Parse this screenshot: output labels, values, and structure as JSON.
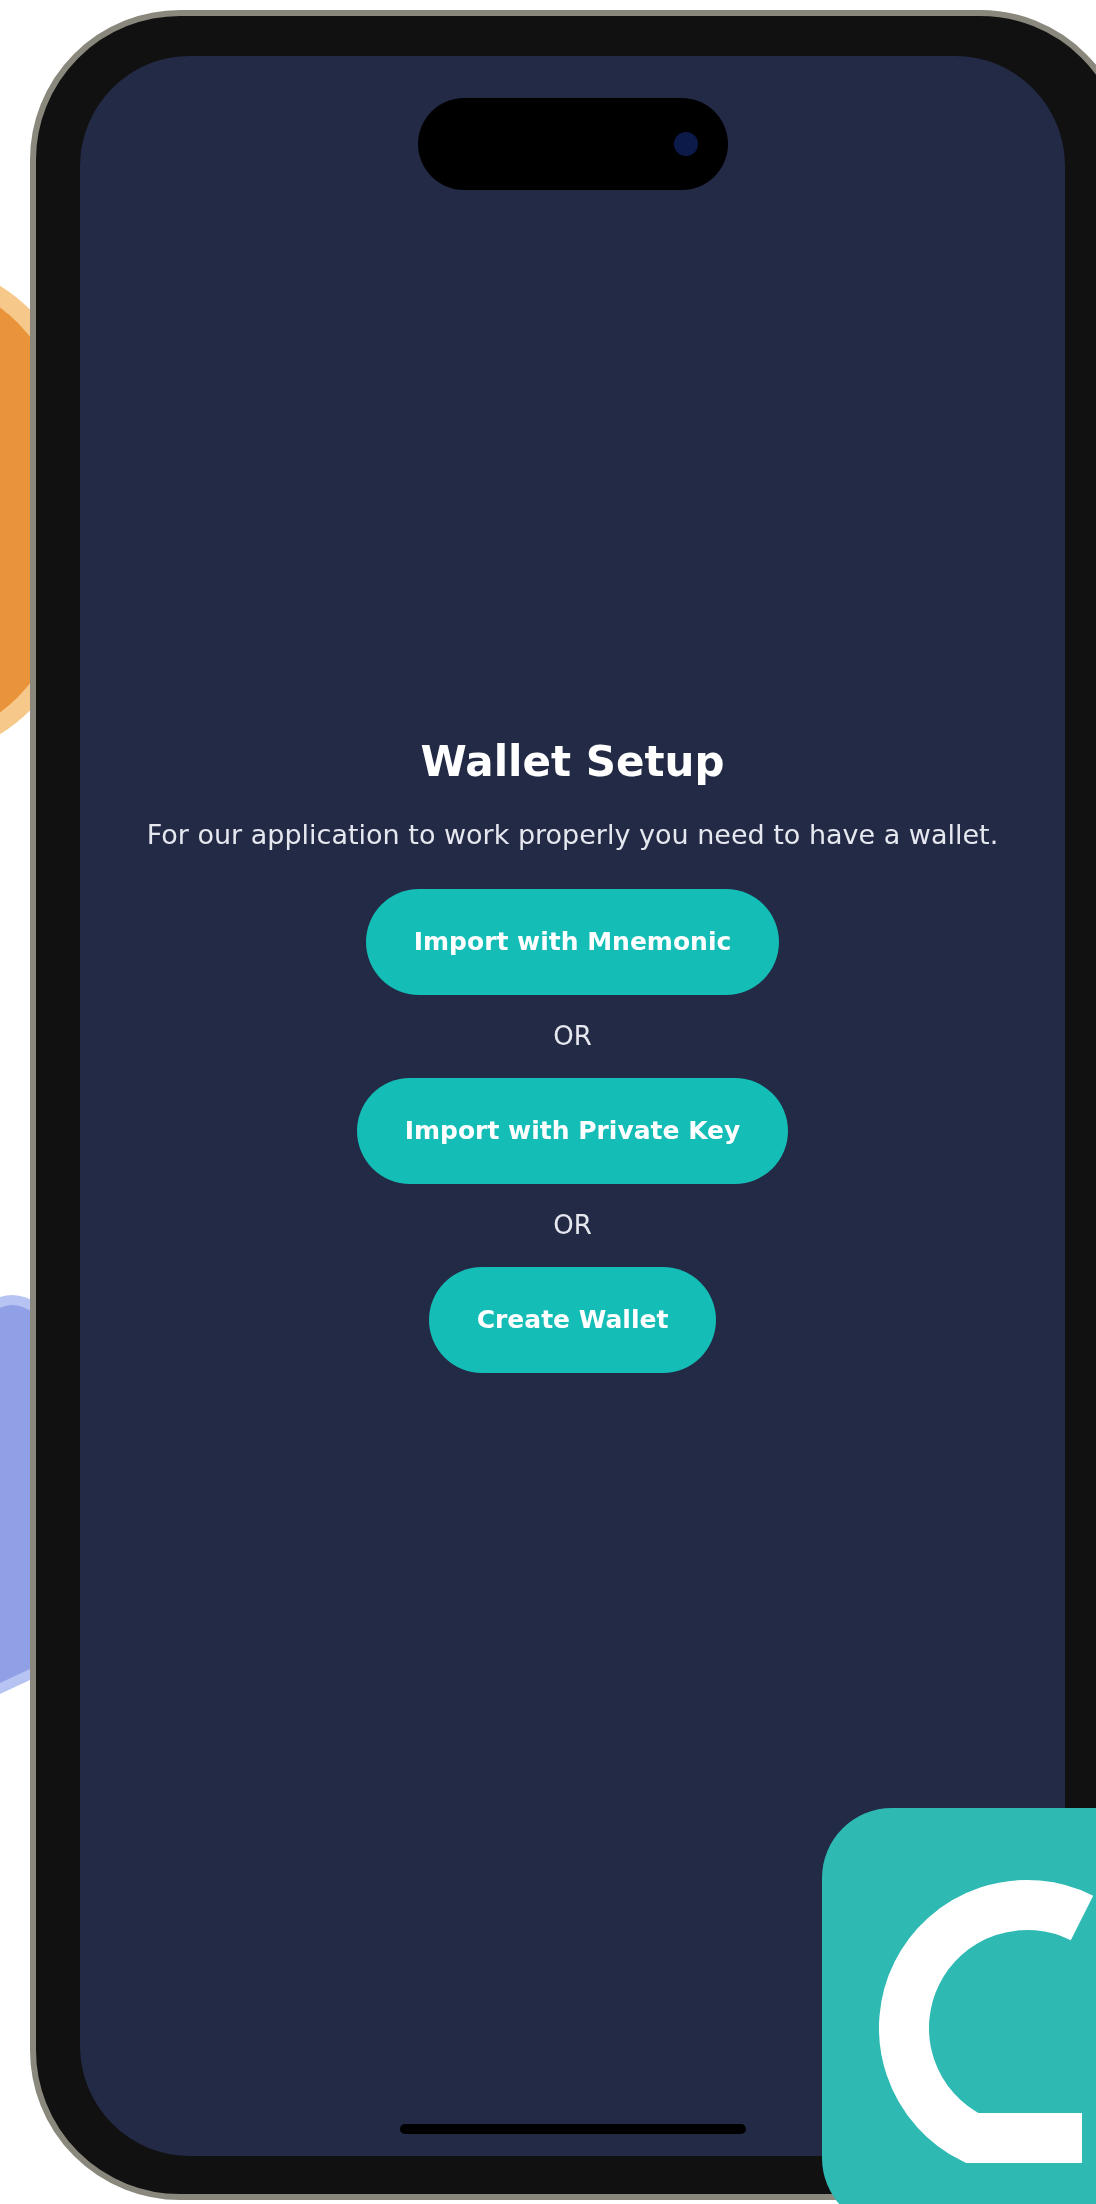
{
  "screen": {
    "title": "Wallet Setup",
    "description": "For our application to work properly you need to have a wallet.",
    "options": [
      {
        "kind": "button",
        "label": "Import with Mnemonic"
      },
      {
        "kind": "separator",
        "label": "OR"
      },
      {
        "kind": "button",
        "label": "Import with Private Key"
      },
      {
        "kind": "separator",
        "label": "OR"
      },
      {
        "kind": "button",
        "label": "Create Wallet"
      }
    ]
  }
}
